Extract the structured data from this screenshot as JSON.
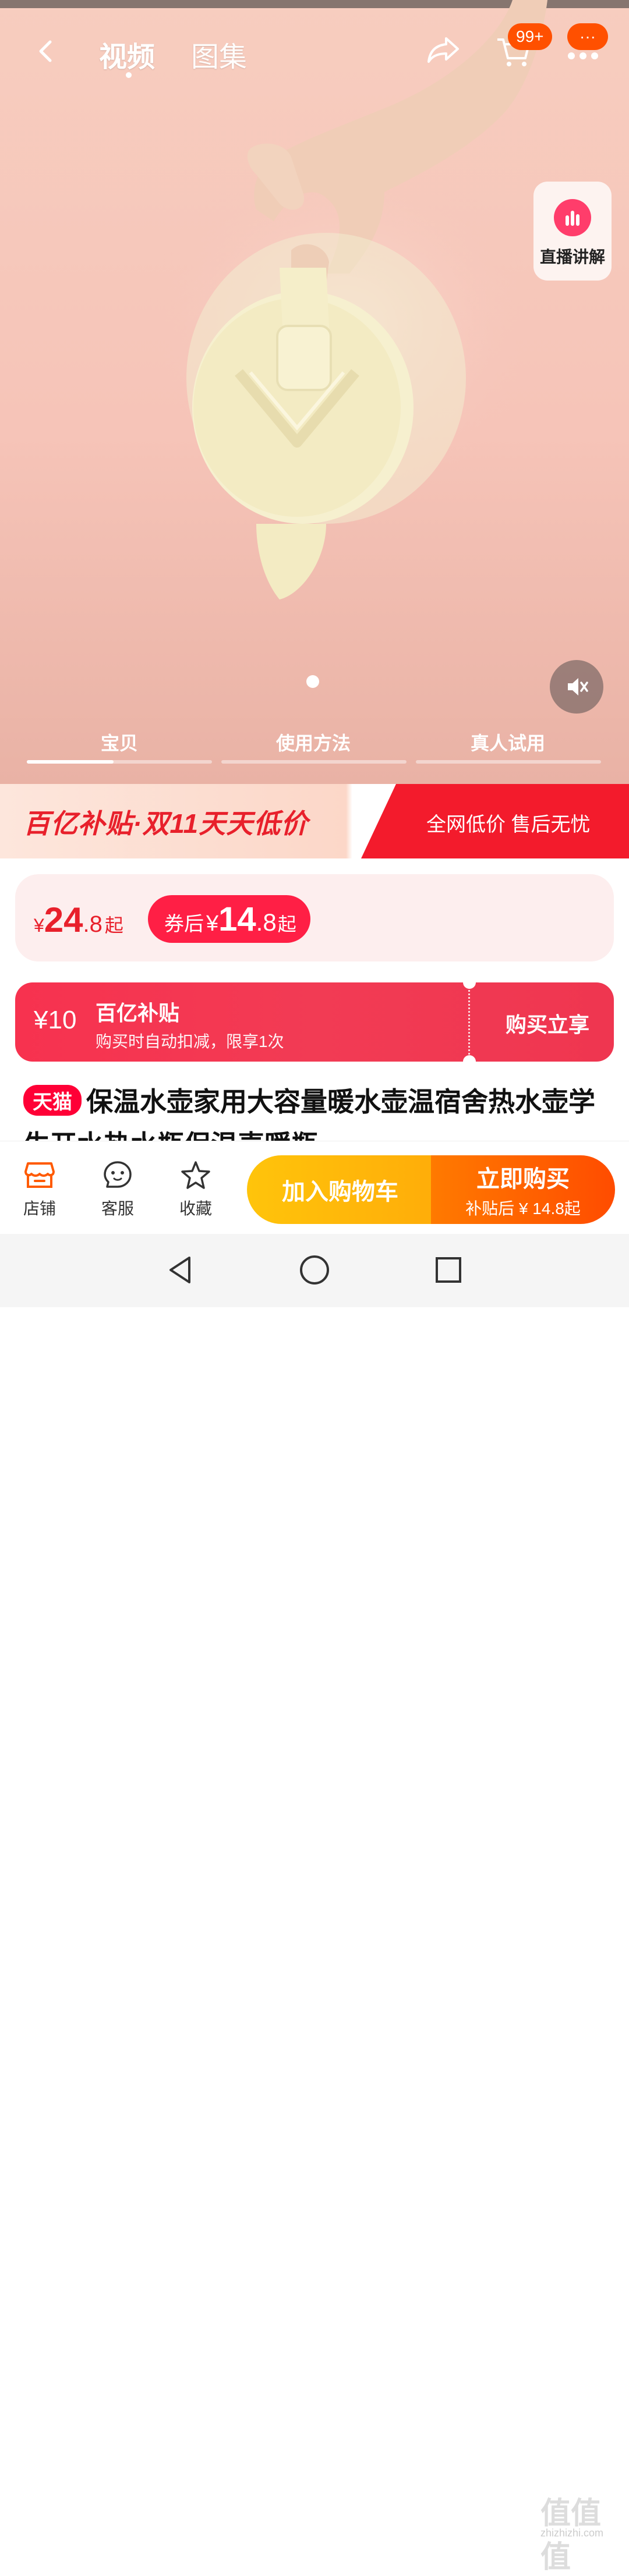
{
  "header": {
    "tabs": [
      {
        "label": "视频",
        "active": true
      },
      {
        "label": "图集",
        "active": false
      }
    ],
    "cart_badge": "99+",
    "more_badge": "···",
    "live_label": "直播讲解"
  },
  "media": {
    "segments": [
      {
        "label": "宝贝",
        "progress": 0.47
      },
      {
        "label": "使用方法",
        "progress": 0
      },
      {
        "label": "真人试用",
        "progress": 0
      }
    ]
  },
  "promo": {
    "left_text": "百亿补贴·双11天天低价",
    "right_text": "全网低价 售后无忧"
  },
  "price": {
    "yen": "¥",
    "int": "24",
    "dec": ".8",
    "suffix": "起",
    "coupon_label": "券后",
    "coupon_yen": "¥",
    "coupon_int": "14",
    "coupon_dec": ".8",
    "coupon_suffix": "起"
  },
  "subsidy": {
    "amount": "¥10",
    "title": "百亿补贴",
    "desc": "购买时自动扣减，限享1次",
    "cta": "购买立享"
  },
  "product": {
    "tag": "天猫",
    "title": "保温水壶家用大容量暖水壶温宿舍热水壶学生开水热水瓶保温壶暖瓶"
  },
  "action_bar": {
    "shop": "店铺",
    "service": "客服",
    "favorite": "收藏",
    "add_to_cart": "加入购物车",
    "buy_now": "立即购买",
    "buy_sub": "补贴后 ¥ 14.8起"
  },
  "watermark": {
    "main": "值值值",
    "sub": "zhizhizhi.com"
  },
  "colors": {
    "accent_red": "#e8202b",
    "tmall_red": "#ff0036",
    "cart_yellow": "#ffc40b",
    "buy_orange": "#ff5a00"
  }
}
